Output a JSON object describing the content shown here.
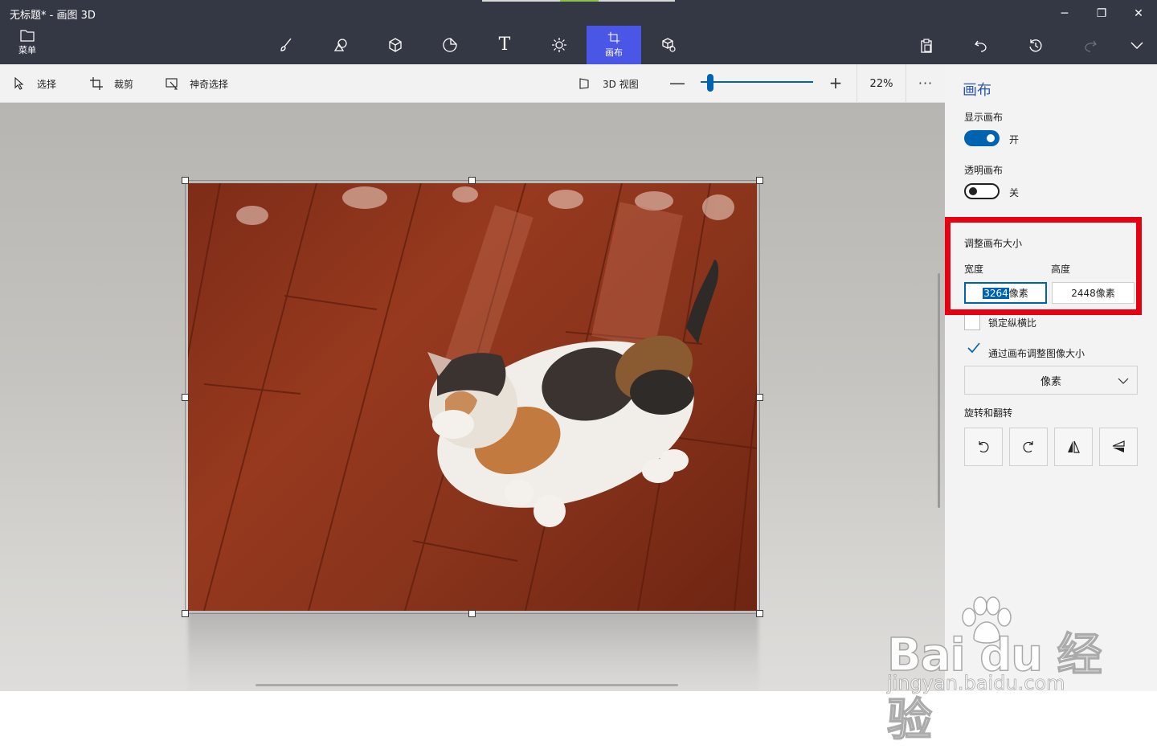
{
  "window": {
    "title": "无标题* - 画图 3D",
    "controls": {
      "minimize": "─",
      "restore": "❐",
      "close": "✕"
    }
  },
  "toolbar": {
    "menu_label": "菜单",
    "tools": [
      {
        "name": "brushes",
        "icon": "brush-icon"
      },
      {
        "name": "2d-shapes",
        "icon": "2d-shapes-icon"
      },
      {
        "name": "3d-shapes",
        "icon": "cube-icon"
      },
      {
        "name": "stickers",
        "icon": "sticker-icon"
      },
      {
        "name": "text",
        "icon": "text-icon",
        "glyph": "T"
      },
      {
        "name": "effects",
        "icon": "sun-icon"
      },
      {
        "name": "canvas",
        "icon": "canvas-icon",
        "label": "画布",
        "active": true
      },
      {
        "name": "3d-library",
        "icon": "3d-library-icon"
      }
    ],
    "right_tools": [
      "paste-icon",
      "undo-icon",
      "history-icon",
      "redo-icon",
      "expand-chevron-icon"
    ]
  },
  "subbar": {
    "select_label": "选择",
    "crop_label": "裁剪",
    "magic_select_label": "神奇选择",
    "view_3d_label": "3D 视图",
    "zoom_minus": "—",
    "zoom_plus": "+",
    "zoom_value": "22%",
    "more": "···",
    "zoom_level": 0.22
  },
  "panel": {
    "title": "画布",
    "show_canvas_label": "显示画布",
    "show_canvas_state": "开",
    "transparent_canvas_label": "透明画布",
    "transparent_canvas_state": "关",
    "resize_label": "调整画布大小",
    "width_label": "宽度",
    "height_label": "高度",
    "width_value": "3264",
    "width_unit": "像素",
    "height_value": "2448像素",
    "lock_ratio_label": "锁定纵横比",
    "resize_image_label": "通过画布调整图像大小",
    "unit_select": "像素",
    "rotate_label": "旋转和翻转"
  },
  "watermark": {
    "logo": "Bai du 经验",
    "url": "jingyan.baidu.com"
  },
  "colors": {
    "titlebar": "#333844",
    "accent": "#0063b1",
    "active_tool": "#4a57e6",
    "panel_title": "#2b56b8",
    "highlight": "#e60012"
  }
}
